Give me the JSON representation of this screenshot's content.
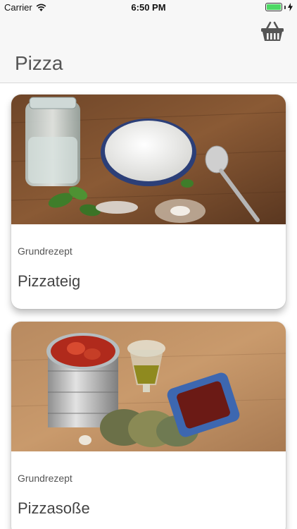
{
  "status_bar": {
    "carrier": "Carrier",
    "time": "6:50 PM",
    "battery_level": 1.0,
    "battery_color": "#4cd964",
    "icons": [
      "wifi-icon",
      "battery-icon",
      "charging-bolt-icon"
    ]
  },
  "header": {
    "title": "Pizza",
    "cart_icon": "basket-icon"
  },
  "recipes": [
    {
      "subtitle": "Grundrezept",
      "title": "Pizzateig",
      "image": "flour-water-basil-photo"
    },
    {
      "subtitle": "Grundrezept",
      "title": "Pizzasoße",
      "image": "tomato-can-herbs-oil-photo"
    }
  ]
}
